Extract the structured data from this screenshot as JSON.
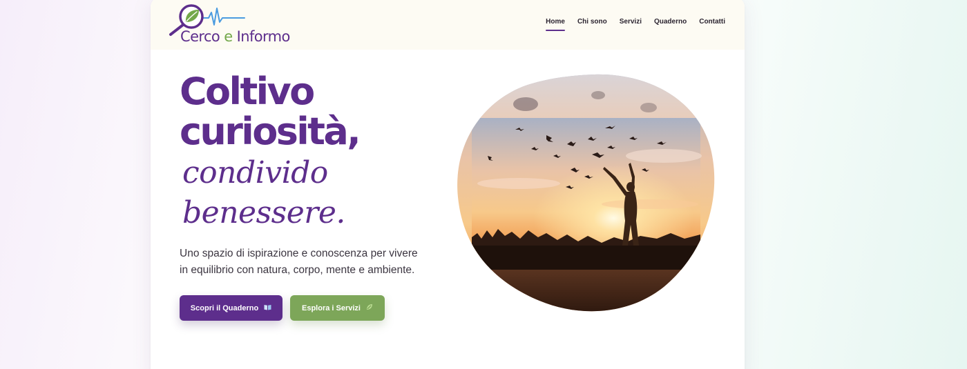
{
  "brand": {
    "logo_words": [
      "Cerco",
      "e",
      "Informo"
    ]
  },
  "nav": {
    "items": [
      "Home",
      "Chi sono",
      "Servizi",
      "Quaderno",
      "Contatti"
    ],
    "active": "Home"
  },
  "hero": {
    "title_lines": [
      "Coltivo",
      "curiosità,"
    ],
    "script_lines": [
      "condivido",
      "benessere."
    ],
    "subtitle": "Uno spazio di ispirazione e conoscenza per vivere in equilibrio con natura, corpo, mente e ambiente.",
    "primary_button": {
      "label": "Scopri il Quaderno",
      "icon": "book-icon"
    },
    "secondary_button": {
      "label": "Esplora i Servizi",
      "icon": "leaf-icon"
    },
    "image": {
      "description_icon": "sunset-birds-woman-photo"
    }
  },
  "colors": {
    "brand_purple": "#5d2e8c",
    "brand_green": "#7da659",
    "header_bg": "#fdfbf3"
  }
}
